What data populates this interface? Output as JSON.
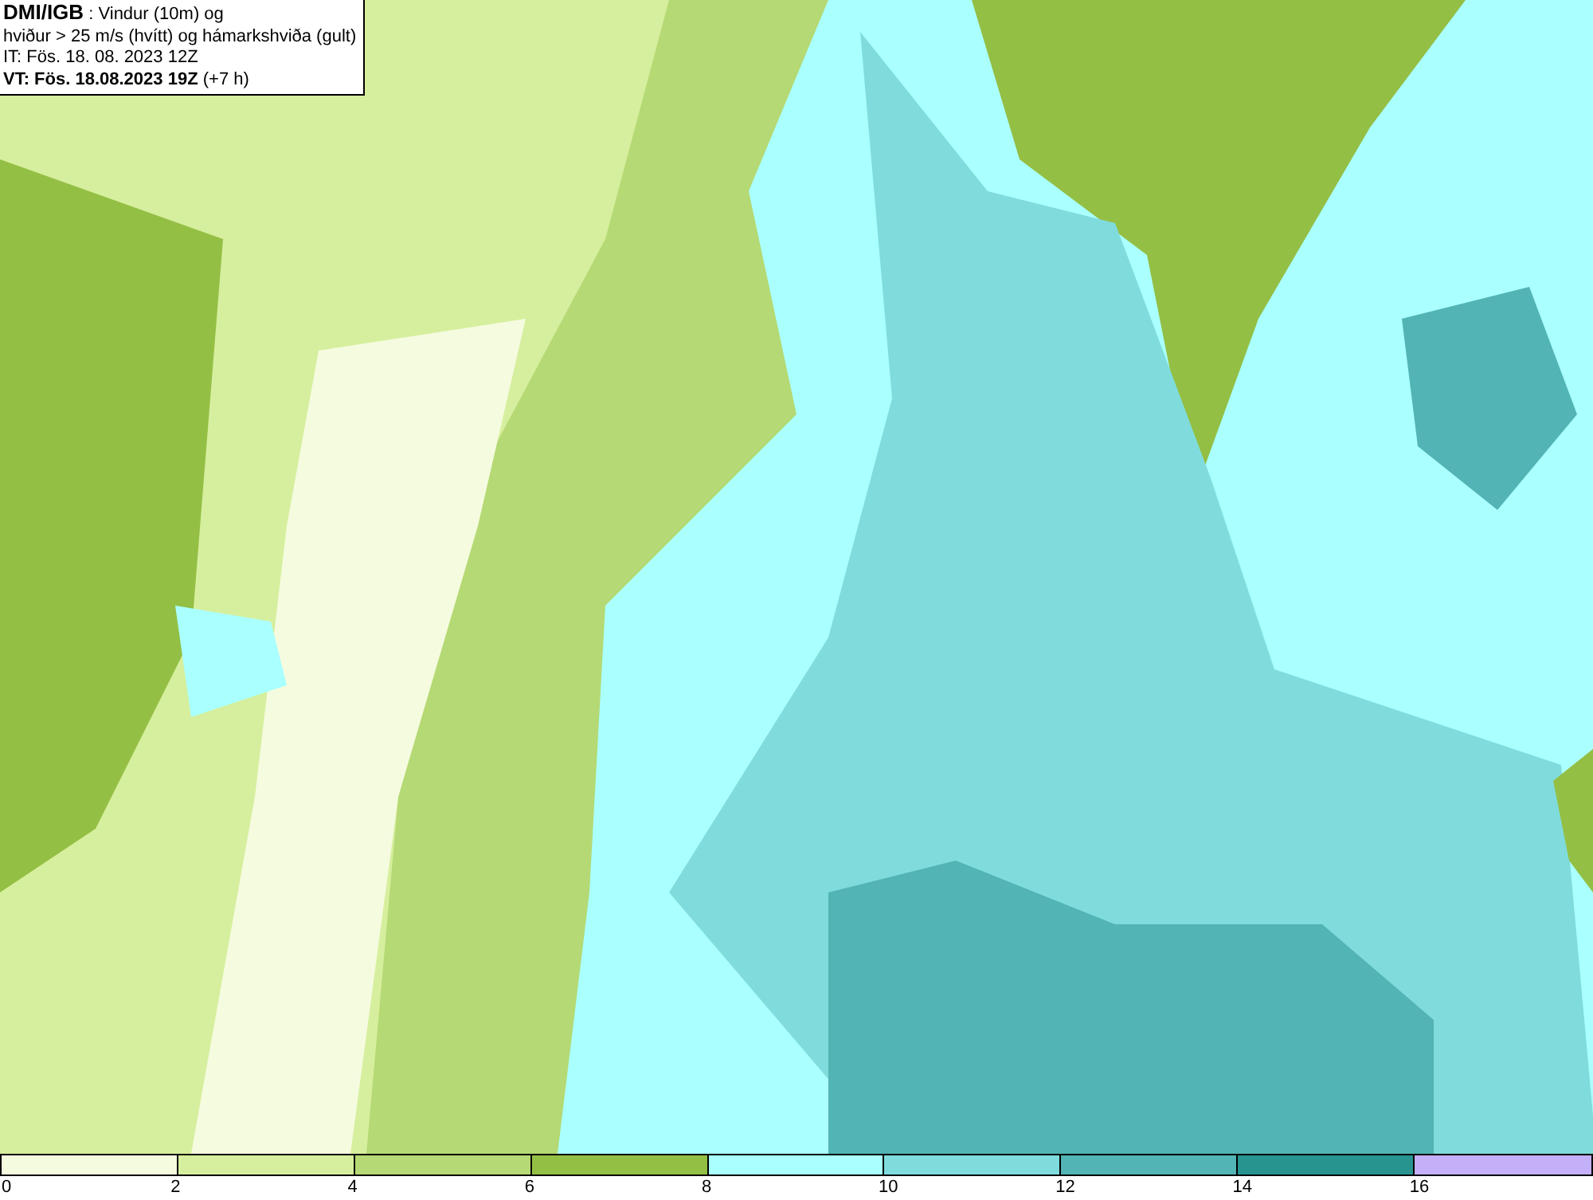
{
  "header": {
    "lines": [
      "**DMI/IGB** : Vindur (10m) og",
      "hviður > 25 m/s (hvítt) og hámarkshviða (gult)",
      "IT: Fös. 18. 08. 2023 12Z",
      "**VT: Fös. 18.08.2023 19Z** (+7 h)"
    ]
  },
  "legend": [
    {
      "label": "0",
      "color": "#f5fbdf"
    },
    {
      "label": "2",
      "color": "#d6ef9e"
    },
    {
      "label": "4",
      "color": "#b5d974"
    },
    {
      "label": "6",
      "color": "#94bf45"
    },
    {
      "label": "8",
      "color": "#aaffff"
    },
    {
      "label": "10",
      "color": "#80dcdc"
    },
    {
      "label": "12",
      "color": "#52b4b4"
    },
    {
      "label": "14",
      "color": "#27948f"
    },
    {
      "label": "16",
      "color": "#c3b0f8"
    }
  ]
}
